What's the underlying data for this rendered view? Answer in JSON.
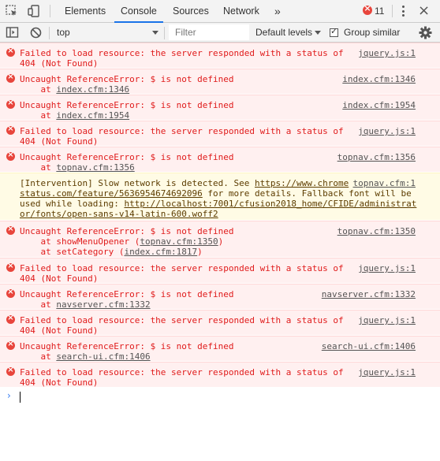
{
  "tabbar": {
    "tabs": [
      {
        "label": "Elements"
      },
      {
        "label": "Console"
      },
      {
        "label": "Sources"
      },
      {
        "label": "Network"
      }
    ],
    "more": "»",
    "error_count": "11"
  },
  "toolbar": {
    "context": "top",
    "filter_placeholder": "Filter",
    "levels": "Default levels",
    "group_similar": "Group similar"
  },
  "messages": {
    "m1": {
      "l1": "Failed to load resource: the server responded with a status of",
      "l2": "404 (Not Found)",
      "src": "jquery.js:1"
    },
    "m2": {
      "l1": "Uncaught ReferenceError: $ is not defined",
      "l2a": "    at ",
      "l2b": "index.cfm:1346",
      "src": "index.cfm:1346"
    },
    "m3": {
      "l1": "Uncaught ReferenceError: $ is not defined",
      "l2a": "    at ",
      "l2b": "index.cfm:1954",
      "src": "index.cfm:1954"
    },
    "m4": {
      "l1": "Failed to load resource: the server responded with a status of",
      "l2": "404 (Not Found)",
      "src": "jquery.js:1"
    },
    "m5": {
      "l1": "Uncaught ReferenceError: $ is not defined",
      "l2a": "    at ",
      "l2b": "topnav.cfm:1356",
      "src": "topnav.cfm:1356"
    },
    "m6": {
      "l1a": "[Intervention] Slow network is detected. See ",
      "l1b": "https://www.chrome",
      "l2a": "status.com/feature/5636954674692096",
      "l2b": " for more details. Fallback font will be",
      "l3a": "used while loading: ",
      "l3b": "http://localhost:7001/cfusion2018_home/CFIDE/administrat",
      "l4": "or/fonts/open-sans-v14-latin-600.woff2",
      "src": "topnav.cfm:1"
    },
    "m7": {
      "l1": "Uncaught ReferenceError: $ is not defined",
      "l2a": "    at showMenuOpener (",
      "l2b": "topnav.cfm:1350",
      "l2c": ")",
      "l3a": "    at setCategory (",
      "l3b": "index.cfm:1817",
      "l3c": ")",
      "src": "topnav.cfm:1350"
    },
    "m8": {
      "l1": "Failed to load resource: the server responded with a status of",
      "l2": "404 (Not Found)",
      "src": "jquery.js:1"
    },
    "m9": {
      "l1": "Uncaught ReferenceError: $ is not defined",
      "l2a": "    at ",
      "l2b": "navserver.cfm:1332",
      "src": "navserver.cfm:1332"
    },
    "m10": {
      "l1": "Failed to load resource: the server responded with a status of",
      "l2": "404 (Not Found)",
      "src": "jquery.js:1"
    },
    "m11": {
      "l1": "Uncaught ReferenceError: $ is not defined",
      "l2a": "    at ",
      "l2b": "search-ui.cfm:1406",
      "src": "search-ui.cfm:1406"
    },
    "m12": {
      "l1": "Failed to load resource: the server responded with a status of",
      "l2": "404 (Not Found)",
      "src": "jquery.js:1"
    }
  },
  "prompt": "›",
  "colors": {
    "error_bg": "#fff0f0",
    "error_text": "#e01b1b",
    "warn_bg": "#fffbe5",
    "accent": "#1a73e8"
  }
}
